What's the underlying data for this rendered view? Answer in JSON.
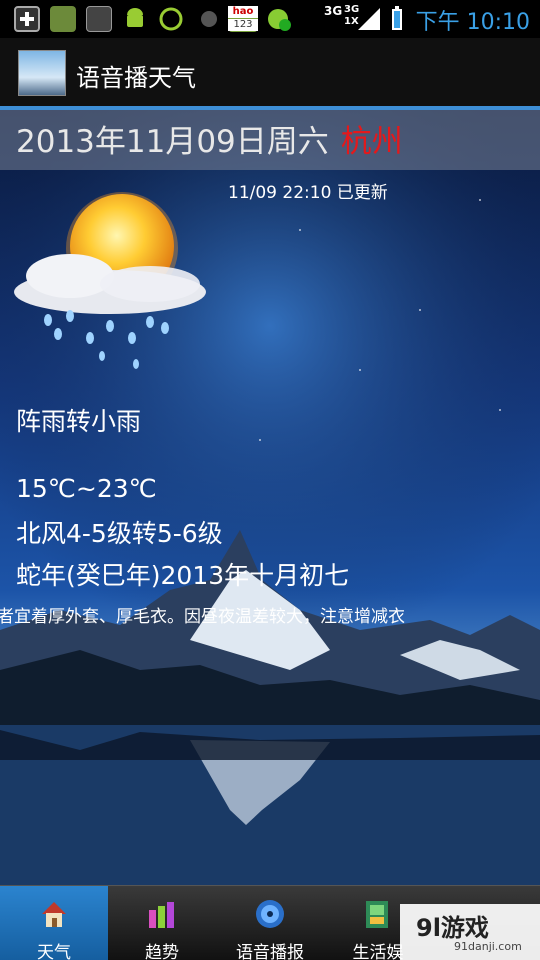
{
  "status_bar": {
    "time": "下午 10:10",
    "network_labels": [
      "3G",
      "3G",
      "1X"
    ],
    "icons": [
      "add-icon",
      "message-icon",
      "sms-icon",
      "android-icon",
      "sync-icon",
      "ball-icon",
      "hao123-icon",
      "app-update-icon",
      "signal-icon",
      "battery-icon"
    ],
    "hao_label": "hao",
    "hao_num": "123"
  },
  "app": {
    "title": "语音播天气"
  },
  "weather": {
    "date": "2013年11月09日周六",
    "city": "杭州",
    "updated": "11/09 22:10 已更新",
    "condition": "阵雨转小雨",
    "temperature": "15℃~23℃",
    "wind": "北风4-5级转5-6级",
    "lunar": "蛇年(癸巳年)2013年十月初七",
    "tip": "弱者宜着厚外套、厚毛衣。因昼夜温差较大，注意增减衣"
  },
  "nav": {
    "items": [
      {
        "label": "天气",
        "icon": "house-icon",
        "active": true
      },
      {
        "label": "趋势",
        "icon": "trend-bars-icon",
        "active": false
      },
      {
        "label": "语音播报",
        "icon": "disc-icon",
        "active": false
      },
      {
        "label": "生活娱",
        "icon": "map-icon",
        "active": false
      }
    ]
  },
  "watermark": {
    "main": "9l游戏",
    "sub": "91danji.com"
  },
  "colors": {
    "accent": "#3e8fd6",
    "city": "#e3191c",
    "time": "#3aa0e6"
  }
}
